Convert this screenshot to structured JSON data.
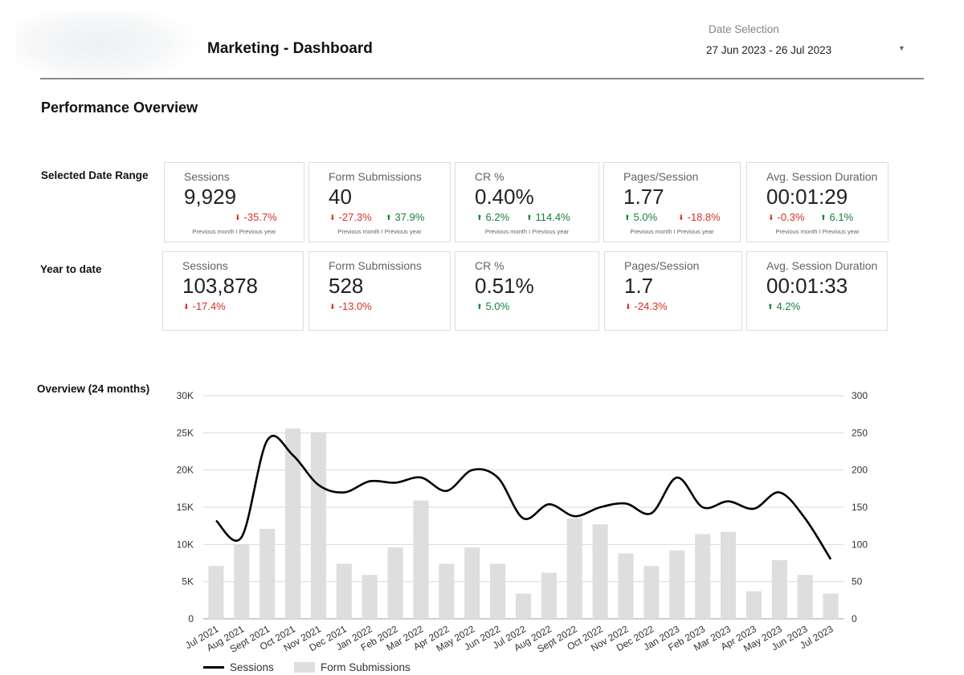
{
  "header": {
    "title": "Marketing - Dashboard",
    "date_selection_label": "Date Selection",
    "date_range": "27 Jun 2023 - 26 Jul 2023",
    "caret_icon": "dropdown-caret-icon"
  },
  "section_title": "Performance Overview",
  "rows": {
    "selected": {
      "label": "Selected Date Range",
      "cards": [
        {
          "label": "Sessions",
          "value": "9,929",
          "delta1": "-35.7%",
          "delta1_dir": "down",
          "delta2": "",
          "delta2_dir": "",
          "note": "Previous month I Previous year"
        },
        {
          "label": "Form Submissions",
          "value": "40",
          "delta1": "-27.3%",
          "delta1_dir": "down",
          "delta2": "37.9%",
          "delta2_dir": "up",
          "note": "Previous month I Previous year"
        },
        {
          "label": "CR %",
          "value": "0.40%",
          "delta1": "6.2%",
          "delta1_dir": "up",
          "delta2": "114.4%",
          "delta2_dir": "up",
          "note": "Previous month I Previous year"
        },
        {
          "label": "Pages/Session",
          "value": "1.77",
          "delta1": "5.0%",
          "delta1_dir": "up",
          "delta2": "-18.8%",
          "delta2_dir": "down",
          "note": "Previous month I Previous year"
        },
        {
          "label": "Avg. Session Duration",
          "value": "00:01:29",
          "delta1": "-0.3%",
          "delta1_dir": "down",
          "delta2": "6.1%",
          "delta2_dir": "up",
          "note": "Previous month I Previous year"
        }
      ]
    },
    "ytd": {
      "label": "Year to date",
      "cards": [
        {
          "label": "Sessions",
          "value": "103,878",
          "delta1": "-17.4%",
          "delta1_dir": "down"
        },
        {
          "label": "Form Submissions",
          "value": "528",
          "delta1": "-13.0%",
          "delta1_dir": "down"
        },
        {
          "label": "CR %",
          "value": "0.51%",
          "delta1": "5.0%",
          "delta1_dir": "up"
        },
        {
          "label": "Pages/Session",
          "value": "1.7",
          "delta1": "-24.3%",
          "delta1_dir": "down"
        },
        {
          "label": "Avg. Session Duration",
          "value": "00:01:33",
          "delta1": "4.2%",
          "delta1_dir": "up"
        }
      ]
    }
  },
  "colors": {
    "down": "#d93025",
    "up": "#188038",
    "bar": "#dedede",
    "line": "#000000",
    "grid": "#d9d9d9"
  },
  "chart_label": "Overview (24 months)",
  "chart_data": {
    "type": "bar",
    "categories": [
      "Jul 2021",
      "Aug 2021",
      "Sept 2021",
      "Oct 2021",
      "Nov 2021",
      "Dec 2021",
      "Jan 2022",
      "Feb 2022",
      "Mar 2022",
      "Apr 2022",
      "May 2022",
      "Jun 2022",
      "Jul 2022",
      "Aug 2022",
      "Sept 2022",
      "Oct 2022",
      "Nov 2022",
      "Dec 2022",
      "Jan 2023",
      "Feb 2023",
      "Mar 2023",
      "Apr 2023",
      "May 2023",
      "Jun 2023",
      "Jul 2023"
    ],
    "series": [
      {
        "name": "Sessions",
        "type": "line",
        "axis": "left",
        "values": [
          13200,
          11000,
          24000,
          22000,
          18000,
          17000,
          18500,
          18300,
          19000,
          17200,
          20000,
          19000,
          13500,
          15400,
          13800,
          15000,
          15500,
          14200,
          19000,
          15000,
          15800,
          14800,
          17000,
          13500,
          8000
        ]
      },
      {
        "name": "Form Submissions",
        "type": "bar",
        "axis": "right",
        "values": [
          71,
          100,
          121,
          256,
          251,
          74,
          59,
          96,
          159,
          74,
          96,
          74,
          34,
          62,
          135,
          127,
          88,
          71,
          92,
          114,
          117,
          37,
          79,
          59,
          34
        ]
      }
    ],
    "y_left": {
      "ticks": [
        "0",
        "5K",
        "10K",
        "15K",
        "20K",
        "25K",
        "30K"
      ],
      "min": 0,
      "max": 30000
    },
    "y_right": {
      "ticks": [
        "0",
        "50",
        "100",
        "150",
        "200",
        "250",
        "300"
      ],
      "min": 0,
      "max": 300
    },
    "grid": true,
    "legend_position": "bottom-left"
  }
}
